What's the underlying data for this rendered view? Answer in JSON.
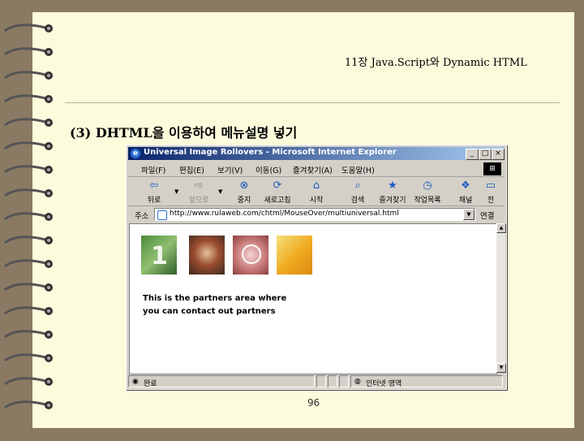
{
  "slide": {
    "header_title": "11장 Java.Script와 Dynamic HTML",
    "heading": "(3) DHTML을 이용하여 메뉴설명 넣기",
    "page_number": "96"
  },
  "browser": {
    "window_title": "Universal Image Rollovers - Microsoft Internet Explorer",
    "caption_buttons": [
      "_",
      "□",
      "×"
    ],
    "menu": [
      "파일(F)",
      "편집(E)",
      "보기(V)",
      "이동(G)",
      "즐겨찾기(A)",
      "도움말(H)"
    ],
    "toolbar": [
      {
        "label": "뒤로",
        "icon": "back-arrow-icon",
        "glyph": "⇦"
      },
      {
        "label": "앞으로",
        "icon": "forward-arrow-icon",
        "glyph": "⇨"
      },
      {
        "label": "중지",
        "icon": "stop-icon",
        "glyph": "⊗"
      },
      {
        "label": "새로고침",
        "icon": "refresh-icon",
        "glyph": "⟳"
      },
      {
        "label": "시작",
        "icon": "home-icon",
        "glyph": "⌂"
      },
      {
        "label": "검색",
        "icon": "search-icon",
        "glyph": "⌕"
      },
      {
        "label": "즐겨찾기",
        "icon": "favorites-icon",
        "glyph": "★"
      },
      {
        "label": "작업목록",
        "icon": "history-icon",
        "glyph": "◷"
      },
      {
        "label": "채널",
        "icon": "channels-icon",
        "glyph": "❖"
      },
      {
        "label": "전",
        "icon": "fullscreen-icon",
        "glyph": "▭"
      }
    ],
    "address_label": "주소",
    "address_url": "http://www.rulaweb.com/chtml/MouseOver/multiuniversal.html",
    "go_label": "연결",
    "content_text_line1": "This is the partners area where",
    "content_text_line2": "you can contact out partners",
    "thumb1_number": "1",
    "status_left": "완료",
    "status_zone": "인터넷 영역"
  }
}
